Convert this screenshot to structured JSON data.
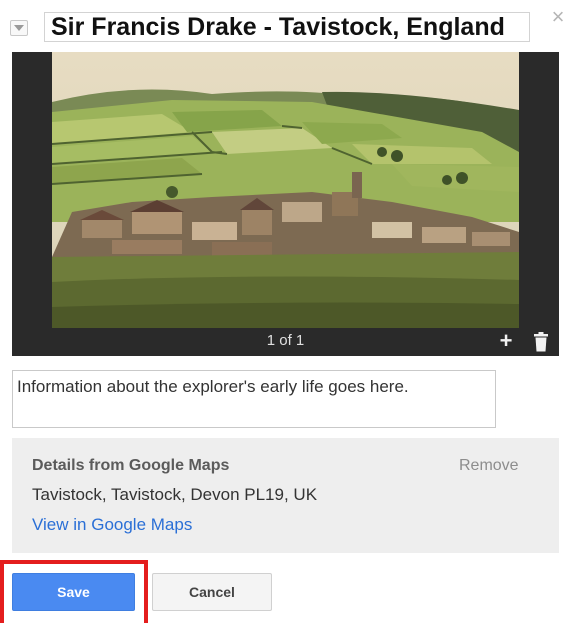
{
  "dialog": {
    "title": "Sir Francis Drake -  Tavistock, England",
    "close_glyph": "×",
    "collapse_icon": "chevron-down-icon"
  },
  "photo": {
    "counter": "1 of 1",
    "add_glyph": "+",
    "delete_icon": "trash-icon"
  },
  "description": {
    "text": "Information about the explorer's early life goes here."
  },
  "details": {
    "title": "Details from Google Maps",
    "remove_label": "Remove",
    "address": "Tavistock, Tavistock, Devon PL19, UK",
    "link_label": "View in Google Maps"
  },
  "actions": {
    "save_label": "Save",
    "cancel_label": "Cancel"
  },
  "colors": {
    "save_button": "#4a8af1",
    "link": "#2a6fd6",
    "highlight": "#e41d1d"
  }
}
